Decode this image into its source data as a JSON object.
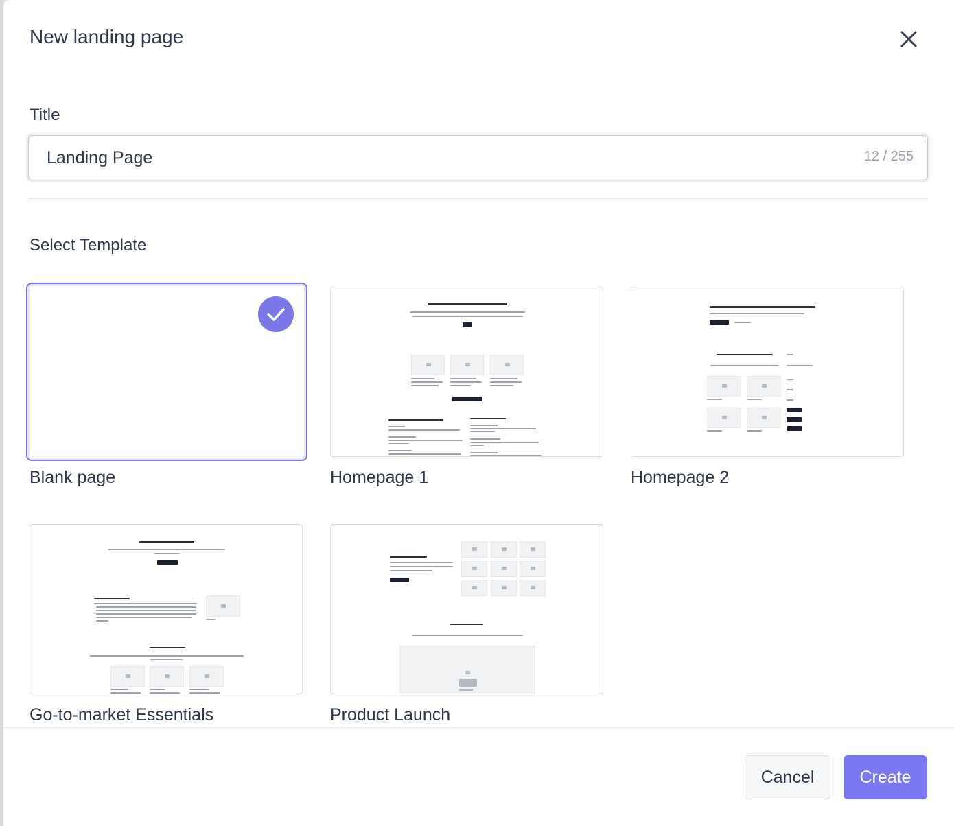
{
  "modal": {
    "title": "New landing page",
    "close_icon": "close-icon"
  },
  "form": {
    "title_label": "Title",
    "title_value": "Landing Page",
    "char_count": "12 / 255",
    "section_label": "Select Template"
  },
  "templates": [
    {
      "name": "Blank page",
      "selected": true
    },
    {
      "name": "Homepage 1",
      "selected": false
    },
    {
      "name": "Homepage 2",
      "selected": false
    },
    {
      "name": "Go-to-market Essentials",
      "selected": false
    },
    {
      "name": "Product Launch",
      "selected": false
    }
  ],
  "footer": {
    "cancel_label": "Cancel",
    "create_label": "Create"
  },
  "colors": {
    "accent": "#7b77f0",
    "text": "#2d3748",
    "muted": "#9aa1ad"
  }
}
